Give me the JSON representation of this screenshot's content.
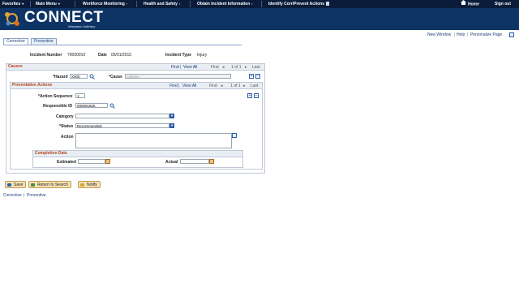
{
  "topnav": {
    "items": [
      "Favorites",
      "Main Menu",
      "Workforce Monitoring",
      "Health and Safety",
      "Obtain Incident Information",
      "Identify Corr/Prevent Actions"
    ],
    "home": "Home",
    "signout": "Sign out"
  },
  "banner": {
    "brand": "CONNECT",
    "tagline": "Maryland Judiciary"
  },
  "toplinks": {
    "new_window": "New Window",
    "help": "Help",
    "personalize": "Personalize Page"
  },
  "tabs": [
    {
      "label": "Corrective",
      "active": true
    },
    {
      "label": "Preventive",
      "active": false
    }
  ],
  "incident": {
    "number_label": "Incident Number",
    "number": "70000010",
    "date_label": "Date",
    "date": "05/01/2015",
    "type_label": "Incident Type",
    "type": "Injury"
  },
  "causes": {
    "title": "Causes",
    "find": "Find",
    "view_all": "View All",
    "first": "First",
    "range": "1 of 1",
    "last": "Last",
    "hazard_label": "*Hazard",
    "hazard_value": "X000",
    "cause_label": "*Cause",
    "cause_value": "Lighting"
  },
  "preventative": {
    "title": "Preventative Actions",
    "find": "Find",
    "view_all": "View All",
    "first": "First",
    "range": "1 of 1",
    "last": "Last",
    "seq_label": "*Action Sequence",
    "seq_value": "1",
    "resp_label": "Responsible ID",
    "resp_value": "000001825",
    "category_label": "Category",
    "category_value": "",
    "status_label": "*Status",
    "status_value": "Recommended",
    "action_label": "Action",
    "action_value": ""
  },
  "completion": {
    "title": "Completion Date",
    "estimated_label": "Estimated",
    "estimated_value": "",
    "actual_label": "Actual",
    "actual_value": ""
  },
  "buttons": {
    "save": "Save",
    "return": "Return to Search",
    "notify": "Notify"
  },
  "footer": {
    "corrective": "Corrective",
    "preventive": "Preventive"
  },
  "colors": {
    "nav_bg": "#0a1c3a",
    "banner_bg": "#0e3466",
    "section_title": "#b5431c",
    "link": "#1b3f7a"
  }
}
